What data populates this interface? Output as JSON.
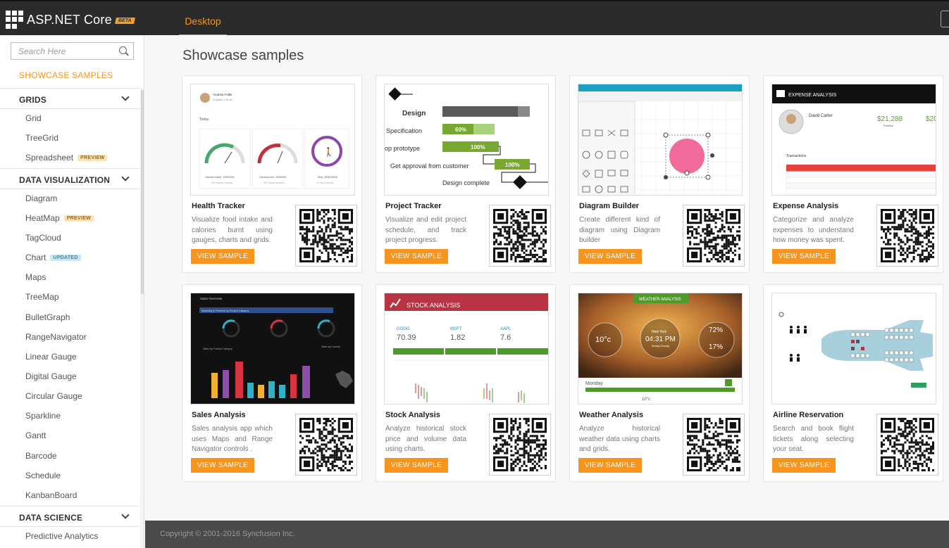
{
  "header": {
    "brand": "ASP.NET Core",
    "beta_badge": "BETA",
    "tab": "Desktop"
  },
  "sidebar": {
    "search_placeholder": "Search Here",
    "showcase_link": "SHOWCASE SAMPLES",
    "sections": [
      {
        "title": "GRIDS",
        "items": [
          {
            "label": "Grid"
          },
          {
            "label": "TreeGrid"
          },
          {
            "label": "Spreadsheet",
            "badge": "PREVIEW"
          }
        ]
      },
      {
        "title": "DATA VISUALIZATION",
        "items": [
          {
            "label": "Diagram"
          },
          {
            "label": "HeatMap",
            "badge": "PREVIEW"
          },
          {
            "label": "TagCloud"
          },
          {
            "label": "Chart",
            "badge": "UPDATED"
          },
          {
            "label": "Maps"
          },
          {
            "label": "TreeMap"
          },
          {
            "label": "BulletGraph"
          },
          {
            "label": "RangeNavigator"
          },
          {
            "label": "Linear Gauge"
          },
          {
            "label": "Digital Gauge"
          },
          {
            "label": "Circular Gauge"
          },
          {
            "label": "Sparkline"
          },
          {
            "label": "Gantt"
          },
          {
            "label": "Barcode"
          },
          {
            "label": "Schedule"
          },
          {
            "label": "KanbanBoard"
          }
        ]
      },
      {
        "title": "DATA SCIENCE",
        "items": [
          {
            "label": "Predictive Analytics"
          }
        ]
      }
    ]
  },
  "main": {
    "title": "Showcase samples",
    "button_label": "VIEW SAMPLE",
    "cards": [
      {
        "name": "Health Tracker",
        "desc": "Visualize food intake and calories burnt using gauges, charts and grids."
      },
      {
        "name": "Project Tracker",
        "desc": "Visualize and edit project schedule, and track project progress."
      },
      {
        "name": "Diagram Builder",
        "desc": "Create different kind of diagram using Diagram builder"
      },
      {
        "name": "Expense Analysis",
        "desc": "Categorize and analyze expenses to understand how money was spent."
      },
      {
        "name": "Sales Analysis",
        "desc": "Sales analysis app which uses Maps and Range Navigator controls ."
      },
      {
        "name": "Stock Analysis",
        "desc": "Analyze historical stock price and volume data using charts."
      },
      {
        "name": "Weather Analysis",
        "desc": "Analyze historical weather data using charts and grids."
      },
      {
        "name": "Airline Reservation",
        "desc": "Search and book flight tickets along selecting your seat."
      }
    ],
    "thumbs": {
      "health": {
        "user": "Andrew Fuller",
        "meta": "34 years | 175 cm",
        "today": "Today",
        "g1": "Calories Intake : 1250/2000",
        "g1s": "1750 calories pending",
        "g2": "Calories burnt : 600/1000",
        "g2s": "400 calories pending",
        "g3": "Step : 8000/10000",
        "g3s": "10 steps pending"
      },
      "project": {
        "r1": "Design",
        "r2": "Specification",
        "r2v": "60%",
        "r3": "op prototype",
        "r3v": "100%",
        "r4": "Get approval from customer",
        "r4v": "100%",
        "r5": "Design complete"
      },
      "expense": {
        "head": "EXPENSE ANALYSIS",
        "user": "David Carter",
        "amount": "$21,288",
        "amount_label": "Positive",
        "amount2": "$20",
        "trans": "Transactions"
      },
      "sales": {
        "head": "Sales Overview",
        "sub": "Marketing to Revenue by Product Category",
        "left": "Sales by Product Category",
        "right": "Sales by Country"
      },
      "stock": {
        "head": "STOCK ANALYSIS",
        "s1": "GOOG",
        "v1": "70.39",
        "s2": "MSFT",
        "v2": "1.82",
        "s3": "AAPL",
        "v3": "7.6"
      },
      "weather": {
        "head": "WEATHER ANALYSIS",
        "t1": "10°c",
        "city": "New York",
        "time": "04:31 PM",
        "cond": "Mostly Cloudy",
        "h1": "72%",
        "h2": "17%",
        "day": "Monday",
        "t2": "10°c"
      }
    }
  },
  "footer": {
    "copyright": "Copyright © 2001-2016 Syncfusion Inc."
  },
  "colors": {
    "accent": "#f7941d",
    "topbar": "#2b2b2b",
    "footer": "#4a4a4a"
  }
}
